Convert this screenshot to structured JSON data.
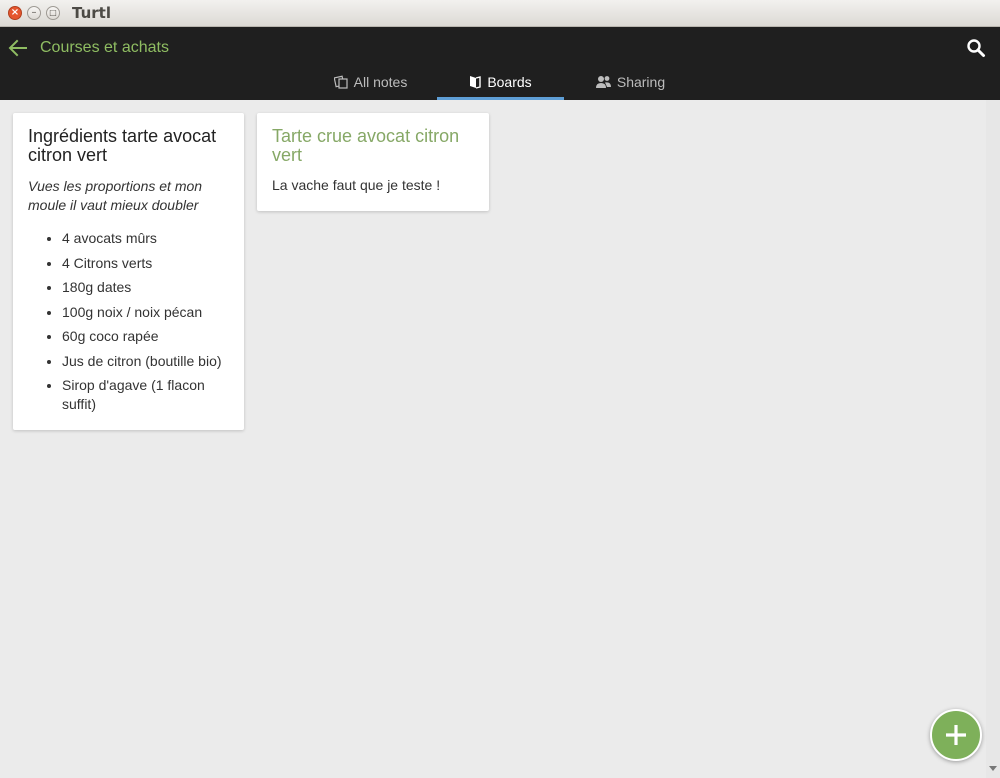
{
  "window": {
    "title": "Turtl",
    "close_glyph": "×",
    "minimize_glyph": "–",
    "maximize_glyph": "□"
  },
  "header": {
    "board_title": "Courses et achats",
    "back_icon": "arrow-left-icon",
    "search_icon": "search-icon"
  },
  "tabs": [
    {
      "label": "All notes",
      "icon": "notes-icon",
      "active": false
    },
    {
      "label": "Boards",
      "icon": "board-icon",
      "active": true
    },
    {
      "label": "Sharing",
      "icon": "users-icon",
      "active": false
    }
  ],
  "notes": [
    {
      "title": "Ingrédients tarte avocat citron vert",
      "description": "Vues les proportions et mon moule il vaut mieux doubler",
      "items": [
        "4 avocats mûrs",
        "4 Citrons verts",
        "180g dates",
        "100g noix / noix pécan",
        "60g coco rapée",
        "Jus de citron (boutille bio)",
        "Sirop d'agave (1 flacon suffit)"
      ]
    },
    {
      "title": "Tarte crue avocat citron vert",
      "body": "La vache faut que je teste !"
    }
  ],
  "colors": {
    "header_bg": "#1f1f1f",
    "accent_green": "#8fbd62",
    "active_tab_underline": "#5e9ed6",
    "fab": "#7eb05a",
    "page_bg": "#ebebeb"
  },
  "fab": {
    "icon": "plus-icon"
  }
}
